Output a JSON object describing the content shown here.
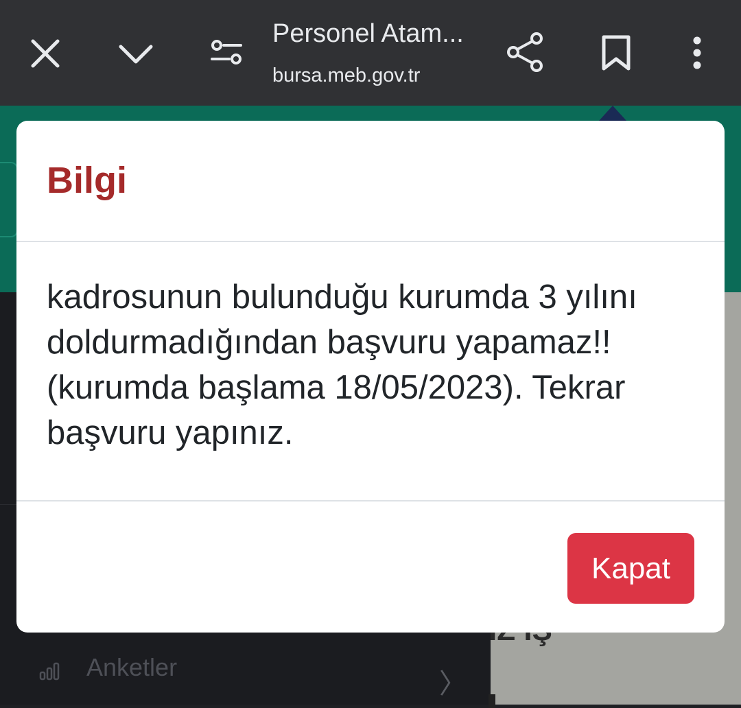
{
  "browser": {
    "title": "Personel Atam...",
    "url": "bursa.meb.gov.tr",
    "icons": [
      "close-icon",
      "chevron-down-icon",
      "page-settings-icon",
      "share-icon",
      "bookmark-icon",
      "more-vert-icon"
    ]
  },
  "page": {
    "sidebar": {
      "item_label": "Anketler",
      "item_icon": "bar-chart-icon",
      "chevron": "〉"
    },
    "partial_text": "IZ İŞ"
  },
  "modal": {
    "title": "Bilgi",
    "message": "kadrosunun bulunduğu kurumda 3 yılını doldurmadığından başvuru yapamaz!! (kurumda başlama 18/05/2023). Tekrar başvuru yapınız.",
    "close_label": "Kapat"
  },
  "colors": {
    "title_color": "#a52a2a",
    "button_color": "#dc3545",
    "header_green": "#0b6b57",
    "toolbar": "#303134"
  }
}
